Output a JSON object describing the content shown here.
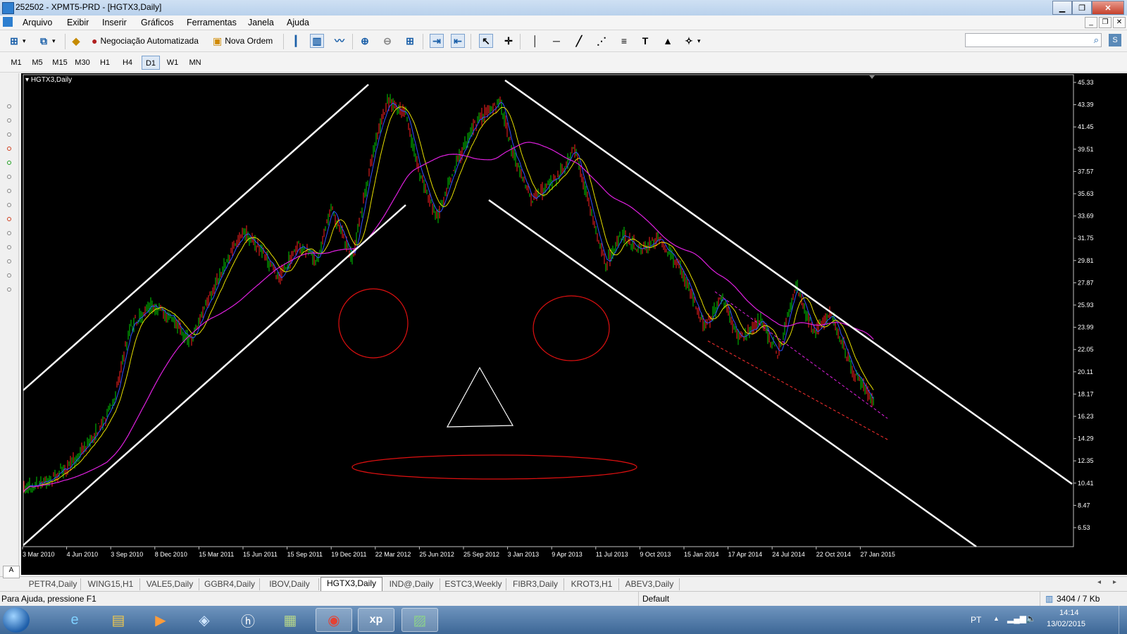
{
  "window": {
    "title": "252502 - XPMT5-PRD - [HGTX3,Daily]",
    "buttons": [
      "▁",
      "❐",
      "✕"
    ]
  },
  "menu": {
    "items": [
      "Arquivo",
      "Exibir",
      "Inserir",
      "Gráficos",
      "Ferramentas",
      "Janela",
      "Ajuda"
    ]
  },
  "toolbar": {
    "auto_trading_label": "Negociação Automatizada",
    "new_order_label": "Nova Ordem"
  },
  "timeframes": {
    "items": [
      "M1",
      "M5",
      "M15",
      "M30",
      "H1",
      "H4",
      "D1",
      "W1",
      "MN"
    ],
    "active": "D1"
  },
  "chart": {
    "header": "HGTX3,Daily",
    "background": "#000000",
    "up_color": "#00d000",
    "down_color": "#ff2020",
    "price_labels": [
      "45.33",
      "43.39",
      "41.45",
      "39.51",
      "37.57",
      "35.63",
      "33.69",
      "31.75",
      "29.81",
      "27.87",
      "25.93",
      "23.99",
      "22.05",
      "20.11",
      "18.17",
      "16.23",
      "14.29",
      "12.35",
      "10.41",
      "8.47",
      "6.53"
    ],
    "date_labels": [
      "3 Mar 2010",
      "4 Jun 2010",
      "3 Sep 2010",
      "8 Dec 2010",
      "15 Mar 2011",
      "15 Jun 2011",
      "15 Sep 2011",
      "19 Dec 2011",
      "22 Mar 2012",
      "25 Jun 2012",
      "25 Sep 2012",
      "3 Jan 2013",
      "9 Apr 2013",
      "11 Jul 2013",
      "9 Oct 2013",
      "15 Jan 2014",
      "17 Apr 2014",
      "24 Jul 2014",
      "22 Oct 2014",
      "27 Jan 2015"
    ]
  },
  "tabs": {
    "items": [
      "PETR4,Daily",
      "WING15,H1",
      "VALE5,Daily",
      "GGBR4,Daily",
      "IBOV,Daily",
      "HGTX3,Daily",
      "IND@,Daily",
      "ESTC3,Weekly",
      "FIBR3,Daily",
      "KROT3,H1",
      "ABEV3,Daily"
    ],
    "active": "HGTX3,Daily"
  },
  "status": {
    "help": "Para Ajuda, pressione F1",
    "profile": "Default",
    "traffic": "3404 / 7 Kb"
  },
  "taskbar": {
    "language": "PT",
    "time": "14:14",
    "date": "13/02/2015"
  }
}
